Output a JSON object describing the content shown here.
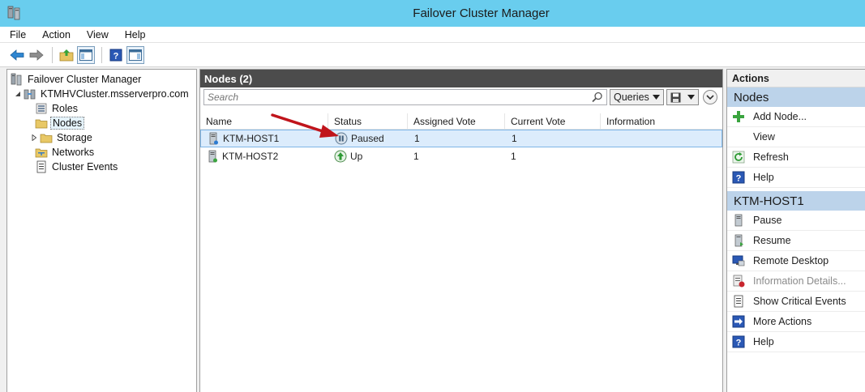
{
  "window": {
    "title": "Failover Cluster Manager"
  },
  "menu": [
    "File",
    "Action",
    "View",
    "Help"
  ],
  "tree": [
    {
      "label": "Failover Cluster Manager",
      "level": 0,
      "icon": "cluster-manager-icon"
    },
    {
      "label": "KTMHVCluster.msserverpro.com",
      "level": 1,
      "icon": "cluster-icon",
      "expanded": true
    },
    {
      "label": "Roles",
      "level": 2,
      "icon": "roles-icon"
    },
    {
      "label": "Nodes",
      "level": 2,
      "icon": "nodes-folder-icon",
      "selected": true
    },
    {
      "label": "Storage",
      "level": 2,
      "icon": "storage-folder-icon",
      "collapsed": true
    },
    {
      "label": "Networks",
      "level": 2,
      "icon": "networks-icon"
    },
    {
      "label": "Cluster Events",
      "level": 2,
      "icon": "cluster-events-icon"
    }
  ],
  "center": {
    "title": "Nodes (2)",
    "search_placeholder": "Search",
    "queries_label": "Queries",
    "columns": [
      "Name",
      "Status",
      "Assigned Vote",
      "Current Vote",
      "Information"
    ],
    "rows": [
      {
        "name": "KTM-HOST1",
        "status": "Paused",
        "status_icon": "pause-icon",
        "assigned": "1",
        "current": "1",
        "info": "",
        "selected": true
      },
      {
        "name": "KTM-HOST2",
        "status": "Up",
        "status_icon": "up-arrow-icon",
        "assigned": "1",
        "current": "1",
        "info": ""
      }
    ]
  },
  "actions": {
    "header": "Actions",
    "groups": [
      {
        "title": "Nodes",
        "items": [
          {
            "label": "Add Node...",
            "icon": "add-node-icon"
          },
          {
            "label": "View",
            "icon": ""
          },
          {
            "label": "Refresh",
            "icon": "refresh-icon"
          },
          {
            "label": "Help",
            "icon": "help-icon"
          }
        ]
      },
      {
        "title": "KTM-HOST1",
        "items": [
          {
            "label": "Pause",
            "icon": "pause-node-icon"
          },
          {
            "label": "Resume",
            "icon": "resume-node-icon"
          },
          {
            "label": "Remote Desktop",
            "icon": "remote-desktop-icon"
          },
          {
            "label": "Information Details...",
            "icon": "information-details-icon",
            "disabled": true
          },
          {
            "label": "Show Critical Events",
            "icon": "critical-events-icon"
          },
          {
            "label": "More Actions",
            "icon": "more-actions-icon"
          },
          {
            "label": "Help",
            "icon": "help-icon"
          }
        ]
      }
    ]
  },
  "colors": {
    "titlebar": "#69cdee",
    "pane_header": "#4c4c4c",
    "action_group": "#bcd3ea",
    "selection": "#dcecfc",
    "annotation_arrow": "#c0141b"
  }
}
